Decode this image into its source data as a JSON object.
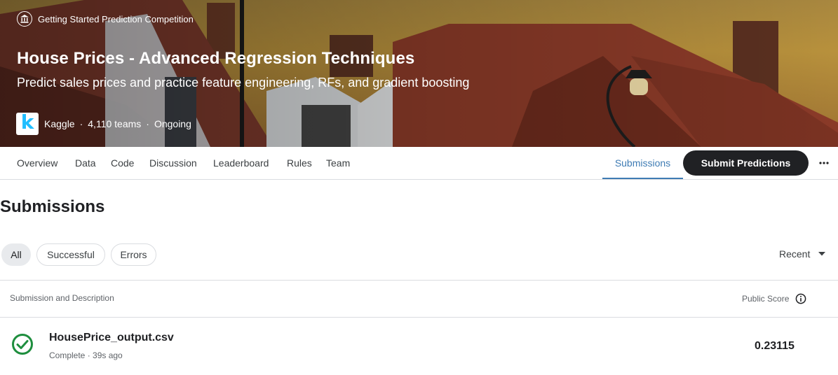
{
  "hero": {
    "competition_type": "Getting Started Prediction Competition",
    "title": "House Prices - Advanced Regression Techniques",
    "subtitle": "Predict sales prices and practice feature engineering, RFs, and gradient boosting",
    "host_logo_letter": "k",
    "host": "Kaggle",
    "teams": "4,110 teams",
    "status": "Ongoing",
    "separator": "·"
  },
  "tabs": {
    "items": [
      "Overview",
      "Data",
      "Code",
      "Discussion",
      "Leaderboard",
      "Rules",
      "Team"
    ],
    "submissions": "Submissions",
    "submit_button": "Submit Predictions"
  },
  "page": {
    "title": "Submissions"
  },
  "filters": {
    "all": "All",
    "successful": "Successful",
    "errors": "Errors",
    "selected": "All"
  },
  "sort": {
    "label": "Recent"
  },
  "table": {
    "col_left": "Submission and Description",
    "col_right": "Public Score",
    "rows": [
      {
        "file_name": "HousePrice_output.csv",
        "meta": "Complete · 39s ago",
        "score": "0.23115",
        "status": "success"
      }
    ]
  },
  "colors": {
    "primary_dark": "#202124",
    "tab_active": "#3f7cb4",
    "success_green": "#1e8e3e",
    "kaggle_blue": "#20beff"
  },
  "icons": {
    "competition_type": "bank-icon",
    "more": "more-horizontal-icon",
    "sort": "caret-down-icon",
    "info": "info-icon",
    "status": "check-circle-icon"
  }
}
